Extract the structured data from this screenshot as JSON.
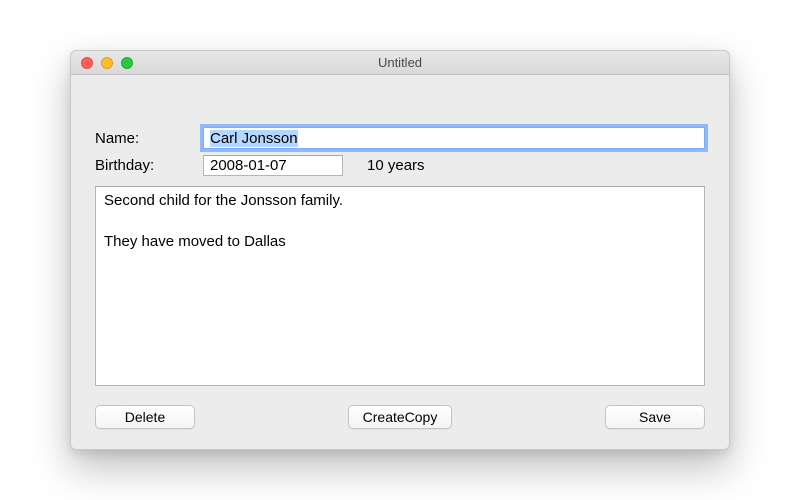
{
  "window": {
    "title": "Untitled"
  },
  "form": {
    "name_label": "Name:",
    "name_value": "Carl Jonsson",
    "birthday_label": "Birthday:",
    "birthday_value": "2008-01-07",
    "age_text": "10 years",
    "notes_value": "Second child for the Jonsson family.\n\nThey have moved to Dallas"
  },
  "buttons": {
    "delete": "Delete",
    "create_copy": "CreateCopy",
    "save": "Save"
  }
}
